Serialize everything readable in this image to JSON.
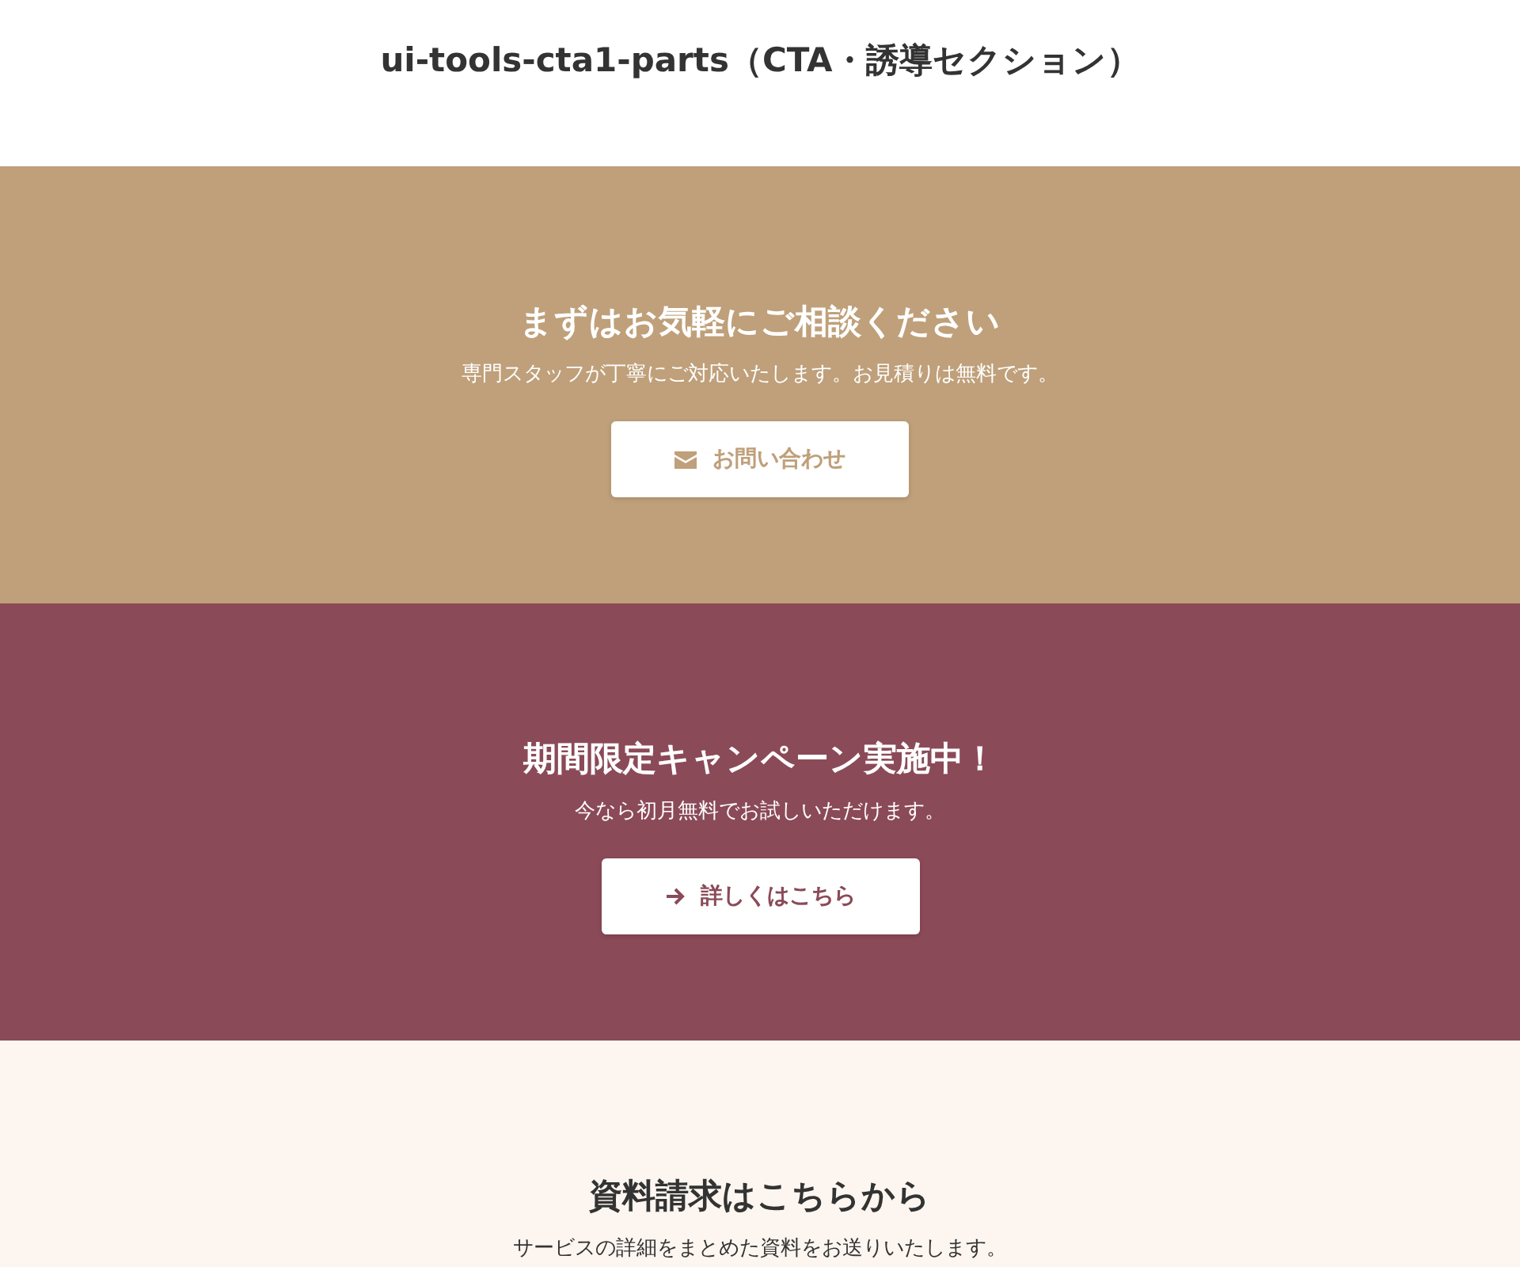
{
  "page_title": "ui-tools-cta1-parts（CTA・誘導セクション）",
  "sections": [
    {
      "heading": "まずはお気軽にご相談ください",
      "text": "専門スタッフが丁寧にご対応いたします。お見積りは無料です。",
      "color": "#bfa07a",
      "button": {
        "label": "お問い合わせ",
        "kind": "mail"
      }
    },
    {
      "heading": "期間限定キャンペーン実施中！",
      "text": "今なら初月無料でお試しいただけます。",
      "color": "#8b4a58",
      "button": {
        "label": "詳しくはこちら",
        "kind": "arrow"
      }
    },
    {
      "heading": "資料請求はこちらから",
      "text": "サービスの詳細をまとめた資料をお送りいたします。",
      "color": "#fdf6f0"
    }
  ]
}
